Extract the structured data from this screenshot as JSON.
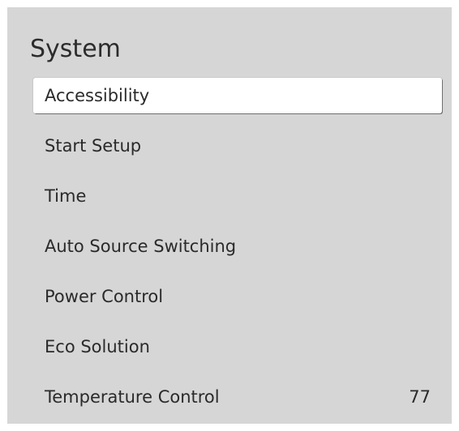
{
  "menu": {
    "title": "System",
    "items": [
      {
        "label": "Accessibility",
        "value": ""
      },
      {
        "label": "Start Setup",
        "value": ""
      },
      {
        "label": "Time",
        "value": ""
      },
      {
        "label": "Auto Source Switching",
        "value": ""
      },
      {
        "label": "Power Control",
        "value": ""
      },
      {
        "label": "Eco Solution",
        "value": ""
      },
      {
        "label": "Temperature Control",
        "value": "77"
      }
    ],
    "selected_index": 0
  },
  "colors": {
    "panel_background": "#d6d6d6",
    "selected_background": "#ffffff",
    "text": "#2a2a2a"
  }
}
